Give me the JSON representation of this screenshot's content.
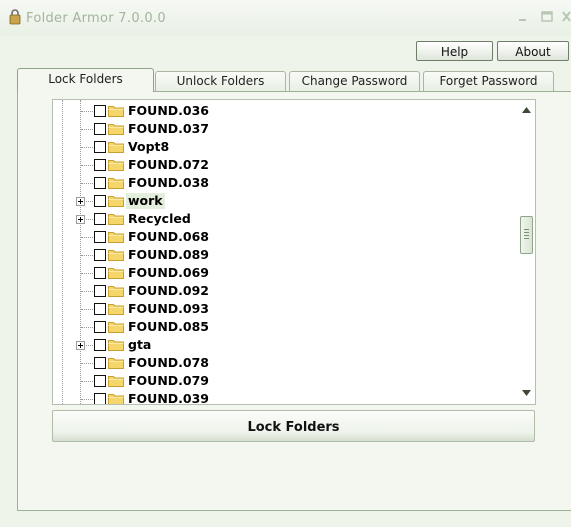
{
  "window": {
    "title": "Folder Armor 7.0.0.0",
    "icon": "app-lock-icon"
  },
  "header_buttons": {
    "help": "Help",
    "about": "About"
  },
  "tabs": [
    {
      "label": "Lock Folders",
      "active": true
    },
    {
      "label": "Unlock Folders",
      "active": false
    },
    {
      "label": "Change Password",
      "active": false
    },
    {
      "label": "Forget Password",
      "active": false
    }
  ],
  "tree": {
    "items": [
      {
        "label": "FOUND.036",
        "expandable": false,
        "checked": false
      },
      {
        "label": "FOUND.037",
        "expandable": false,
        "checked": false
      },
      {
        "label": "Vopt8",
        "expandable": false,
        "checked": false
      },
      {
        "label": "FOUND.072",
        "expandable": false,
        "checked": false
      },
      {
        "label": "FOUND.038",
        "expandable": false,
        "checked": false
      },
      {
        "label": "work",
        "expandable": true,
        "checked": false,
        "highlighted": true
      },
      {
        "label": "Recycled",
        "expandable": true,
        "checked": false
      },
      {
        "label": "FOUND.068",
        "expandable": false,
        "checked": false
      },
      {
        "label": "FOUND.089",
        "expandable": false,
        "checked": false
      },
      {
        "label": "FOUND.069",
        "expandable": false,
        "checked": false
      },
      {
        "label": "FOUND.092",
        "expandable": false,
        "checked": false
      },
      {
        "label": "FOUND.093",
        "expandable": false,
        "checked": false
      },
      {
        "label": "FOUND.085",
        "expandable": false,
        "checked": false
      },
      {
        "label": "gta",
        "expandable": true,
        "checked": false
      },
      {
        "label": "FOUND.078",
        "expandable": false,
        "checked": false
      },
      {
        "label": "FOUND.079",
        "expandable": false,
        "checked": false
      },
      {
        "label": "FOUND.039",
        "expandable": false,
        "checked": false
      }
    ]
  },
  "actions": {
    "lock_folders": "Lock Folders"
  },
  "colors": {
    "background": "#eef4ea",
    "title_text": "#a3b49d",
    "folder_yellow": "#f5d66a",
    "highlight": "#e3eedd"
  }
}
